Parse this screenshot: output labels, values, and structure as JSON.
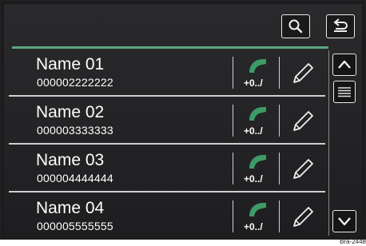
{
  "topbar": {
    "search_icon": "search-icon",
    "back_icon": "back-arrow-icon"
  },
  "contacts": [
    {
      "name": "Name 01",
      "number": "000002222222",
      "call_hint": "+0../"
    },
    {
      "name": "Name 02",
      "number": "000003333333",
      "call_hint": "+0../"
    },
    {
      "name": "Name 03",
      "number": "000004444444",
      "call_hint": "+0../"
    },
    {
      "name": "Name 04",
      "number": "000005555555",
      "call_hint": "+0../"
    }
  ],
  "scrollbar": {
    "up_icon": "chevron-up-icon",
    "thumb_icon": "scroll-thumb-lines-icon",
    "down_icon": "chevron-down-icon"
  },
  "colors": {
    "accent": "#5aa77e",
    "phone": "#3e9a66",
    "background": "#1e1e20",
    "text": "#ffffff"
  },
  "image_code": "Bra-2448"
}
